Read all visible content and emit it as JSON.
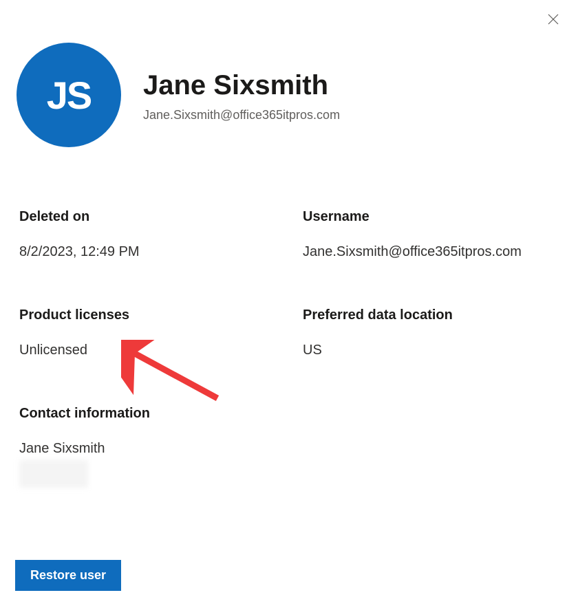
{
  "header": {
    "initials": "JS",
    "name": "Jane Sixsmith",
    "email": "Jane.Sixsmith@office365itpros.com"
  },
  "fields": {
    "deleted_on": {
      "label": "Deleted on",
      "value": "8/2/2023, 12:49 PM"
    },
    "username": {
      "label": "Username",
      "value": "Jane.Sixsmith@office365itpros.com"
    },
    "product_licenses": {
      "label": "Product licenses",
      "value": "Unlicensed"
    },
    "preferred_data_location": {
      "label": "Preferred data location",
      "value": "US"
    },
    "contact_information": {
      "label": "Contact information",
      "value": "Jane Sixsmith"
    }
  },
  "footer": {
    "restore_label": "Restore user"
  }
}
